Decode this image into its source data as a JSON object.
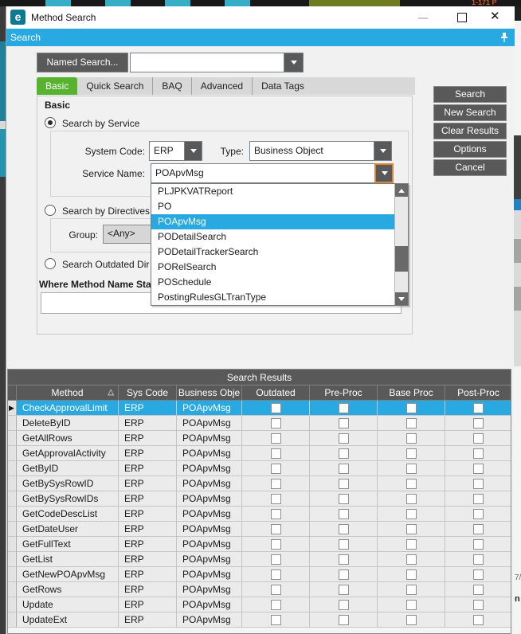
{
  "colors": {
    "accent_blue": "#29a9e1",
    "active_tab_green": "#57b32f",
    "button_gray": "#595959",
    "focus_orange": "#d8863b",
    "logo_teal": "#0d7a94"
  },
  "background": {
    "top_fragment": "1-171 P",
    "right_fragment_1": "7/",
    "right_fragment_2": "n"
  },
  "window": {
    "title": "Method Search",
    "logo_letter": "e",
    "close_glyph": "✕"
  },
  "panel": {
    "title": "Search"
  },
  "named_search": {
    "button_label": "Named Search...",
    "combo_value": ""
  },
  "tabs": [
    {
      "label": "Basic",
      "active": true
    },
    {
      "label": "Quick Search",
      "active": false
    },
    {
      "label": "BAQ",
      "active": false
    },
    {
      "label": "Advanced",
      "active": false
    },
    {
      "label": "Data Tags",
      "active": false
    }
  ],
  "form": {
    "group_title": "Basic",
    "radio_service_label": "Search by Service",
    "system_code_label": "System Code:",
    "system_code_value": "ERP",
    "type_label": "Type:",
    "type_value": "Business Object",
    "service_name_label": "Service Name:",
    "service_name_value": "POApvMsg",
    "radio_directives_label": "Search by Directives",
    "group_label": "Group:",
    "group_value": "<Any>",
    "radio_outdated_label": "Search Outdated Dir",
    "where_label": "Where Method Name Sta",
    "where_value": ""
  },
  "service_dropdown": {
    "selected": "POApvMsg",
    "items": [
      "PLJPKVATReport",
      "PO",
      "POApvMsg",
      "PODetailSearch",
      "PODetailTrackerSearch",
      "PORelSearch",
      "POSchedule",
      "PostingRulesGLTranType"
    ]
  },
  "side_buttons": [
    "Search",
    "New Search",
    "Clear Results",
    "Options",
    "Cancel"
  ],
  "results": {
    "title": "Search Results",
    "sort_indicator": "△",
    "selected_row_marker": "▶",
    "columns": [
      "Method",
      "Sys Code",
      "Business Obje",
      "Outdated",
      "Pre-Proc",
      "Base Proc",
      "Post-Proc"
    ],
    "rows": [
      {
        "method": "CheckApprovalLimit",
        "sys_code": "ERP",
        "business_object": "POApvMsg",
        "outdated": false,
        "pre_proc": false,
        "base_proc": false,
        "post_proc": false,
        "selected": true
      },
      {
        "method": "DeleteByID",
        "sys_code": "ERP",
        "business_object": "POApvMsg",
        "outdated": false,
        "pre_proc": false,
        "base_proc": false,
        "post_proc": false,
        "selected": false
      },
      {
        "method": "GetAllRows",
        "sys_code": "ERP",
        "business_object": "POApvMsg",
        "outdated": false,
        "pre_proc": false,
        "base_proc": false,
        "post_proc": false,
        "selected": false
      },
      {
        "method": "GetApprovalActivity",
        "sys_code": "ERP",
        "business_object": "POApvMsg",
        "outdated": false,
        "pre_proc": false,
        "base_proc": false,
        "post_proc": false,
        "selected": false
      },
      {
        "method": "GetByID",
        "sys_code": "ERP",
        "business_object": "POApvMsg",
        "outdated": false,
        "pre_proc": false,
        "base_proc": false,
        "post_proc": false,
        "selected": false
      },
      {
        "method": "GetBySysRowID",
        "sys_code": "ERP",
        "business_object": "POApvMsg",
        "outdated": false,
        "pre_proc": false,
        "base_proc": false,
        "post_proc": false,
        "selected": false
      },
      {
        "method": "GetBySysRowIDs",
        "sys_code": "ERP",
        "business_object": "POApvMsg",
        "outdated": false,
        "pre_proc": false,
        "base_proc": false,
        "post_proc": false,
        "selected": false
      },
      {
        "method": "GetCodeDescList",
        "sys_code": "ERP",
        "business_object": "POApvMsg",
        "outdated": false,
        "pre_proc": false,
        "base_proc": false,
        "post_proc": false,
        "selected": false
      },
      {
        "method": "GetDateUser",
        "sys_code": "ERP",
        "business_object": "POApvMsg",
        "outdated": false,
        "pre_proc": false,
        "base_proc": false,
        "post_proc": false,
        "selected": false
      },
      {
        "method": "GetFullText",
        "sys_code": "ERP",
        "business_object": "POApvMsg",
        "outdated": false,
        "pre_proc": false,
        "base_proc": false,
        "post_proc": false,
        "selected": false
      },
      {
        "method": "GetList",
        "sys_code": "ERP",
        "business_object": "POApvMsg",
        "outdated": false,
        "pre_proc": false,
        "base_proc": false,
        "post_proc": false,
        "selected": false
      },
      {
        "method": "GetNewPOApvMsg",
        "sys_code": "ERP",
        "business_object": "POApvMsg",
        "outdated": false,
        "pre_proc": false,
        "base_proc": false,
        "post_proc": false,
        "selected": false
      },
      {
        "method": "GetRows",
        "sys_code": "ERP",
        "business_object": "POApvMsg",
        "outdated": false,
        "pre_proc": false,
        "base_proc": false,
        "post_proc": false,
        "selected": false
      },
      {
        "method": "Update",
        "sys_code": "ERP",
        "business_object": "POApvMsg",
        "outdated": false,
        "pre_proc": false,
        "base_proc": false,
        "post_proc": false,
        "selected": false
      },
      {
        "method": "UpdateExt",
        "sys_code": "ERP",
        "business_object": "POApvMsg",
        "outdated": false,
        "pre_proc": false,
        "base_proc": false,
        "post_proc": false,
        "selected": false
      }
    ]
  }
}
